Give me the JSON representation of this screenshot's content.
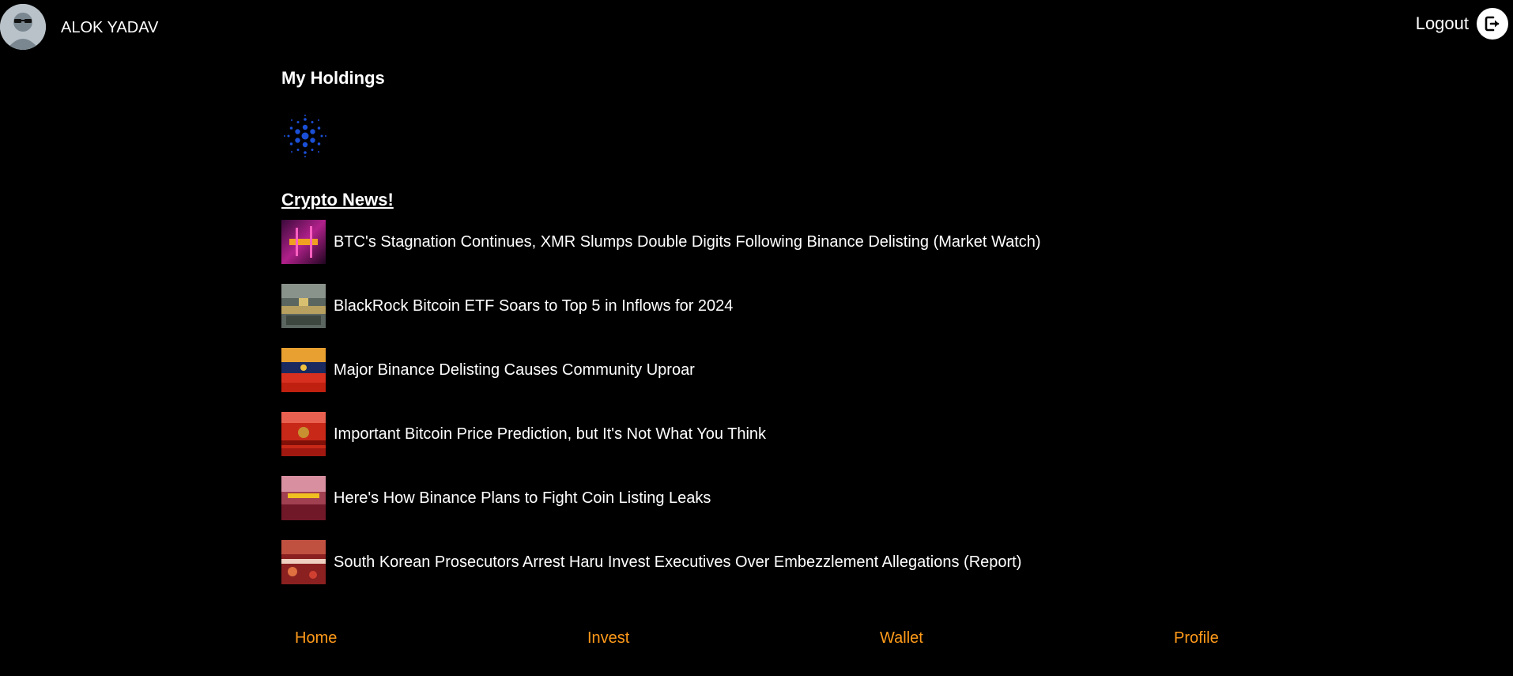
{
  "header": {
    "user_name": "ALOK YADAV",
    "logout_label": "Logout"
  },
  "holdings": {
    "title": "My Holdings",
    "items": [
      {
        "icon": "cardano-icon"
      }
    ]
  },
  "news": {
    "title": "Crypto News!",
    "items": [
      {
        "headline": "BTC's Stagnation Continues, XMR Slumps Double Digits Following Binance Delisting (Market Watch)"
      },
      {
        "headline": "BlackRock Bitcoin ETF Soars to Top 5 in Inflows for 2024"
      },
      {
        "headline": "Major Binance Delisting Causes Community Uproar"
      },
      {
        "headline": "Important Bitcoin Price Prediction, but It's Not What You Think"
      },
      {
        "headline": "Here's How Binance Plans to Fight Coin Listing Leaks"
      },
      {
        "headline": "South Korean Prosecutors Arrest Haru Invest Executives Over Embezzlement Allegations (Report)"
      }
    ]
  },
  "nav": {
    "home": "Home",
    "invest": "Invest",
    "wallet": "Wallet",
    "profile": "Profile"
  },
  "colors": {
    "background": "#000000",
    "text": "#ffffff",
    "nav_accent": "#ff9a1a",
    "cardano_blue": "#1a4fd6"
  }
}
